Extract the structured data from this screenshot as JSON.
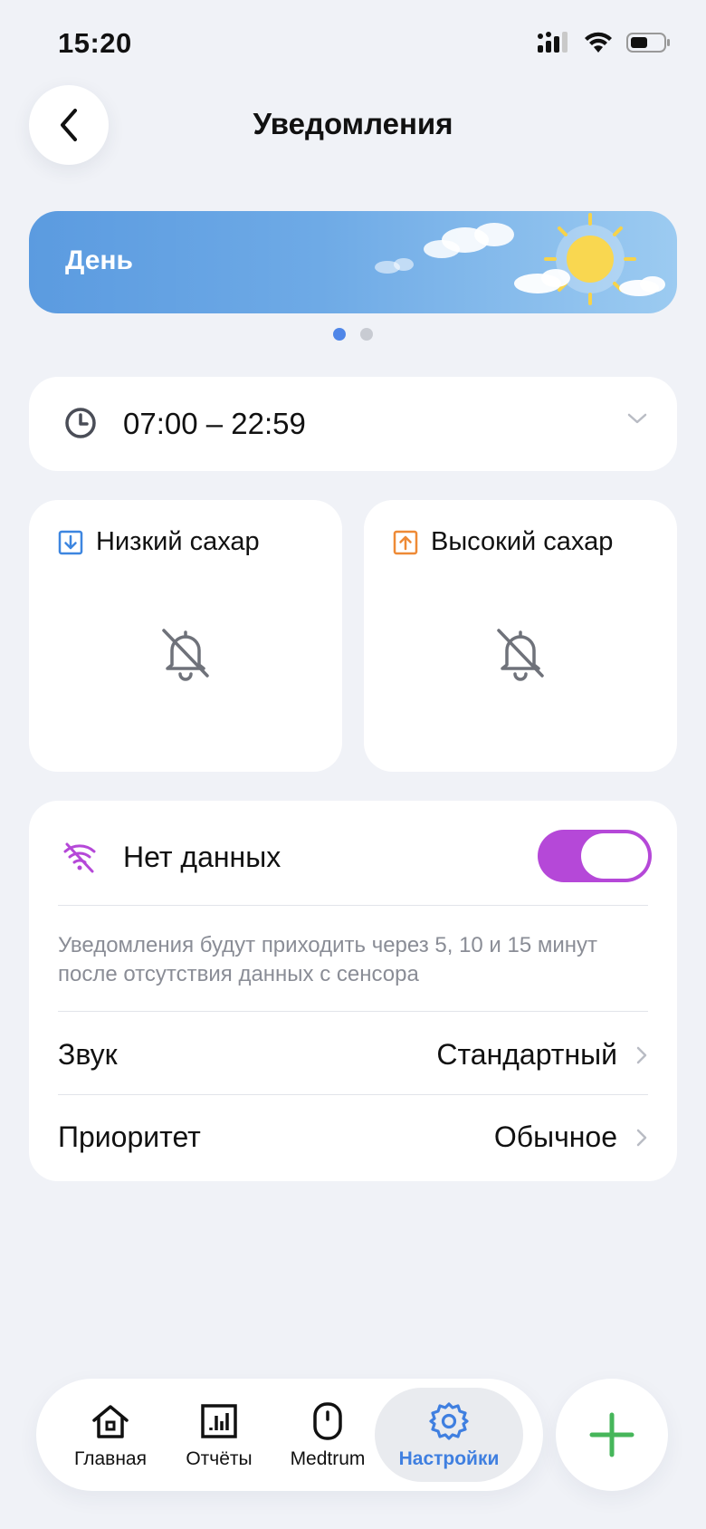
{
  "status_bar": {
    "time": "15:20"
  },
  "header": {
    "title": "Уведомления"
  },
  "banner": {
    "label": "День",
    "page_count": 2,
    "active_page": 1
  },
  "time_range": {
    "value": "07:00 – 22:59"
  },
  "alarms": {
    "low": {
      "title": "Низкий сахар",
      "icon": "arrow-down-box-icon",
      "color": "#3d86e0",
      "notifications": "off"
    },
    "high": {
      "title": "Высокий сахар",
      "icon": "arrow-up-box-icon",
      "color": "#ee8a36",
      "notifications": "off"
    }
  },
  "no_data": {
    "title": "Нет данных",
    "enabled": true,
    "description": "Уведомления будут приходить через 5, 10 и 15 минут после отсутствия данных с сенсора",
    "sound_label": "Звук",
    "sound_value": "Стандартный",
    "priority_label": "Приоритет",
    "priority_value": "Обычное"
  },
  "nav": {
    "home": "Главная",
    "reports": "Отчёты",
    "device": "Medtrum",
    "settings": "Настройки",
    "active": "settings"
  },
  "colors": {
    "accent": "#3f7fe0",
    "toggle": "#b548d8",
    "fab_plus": "#46b65a"
  }
}
